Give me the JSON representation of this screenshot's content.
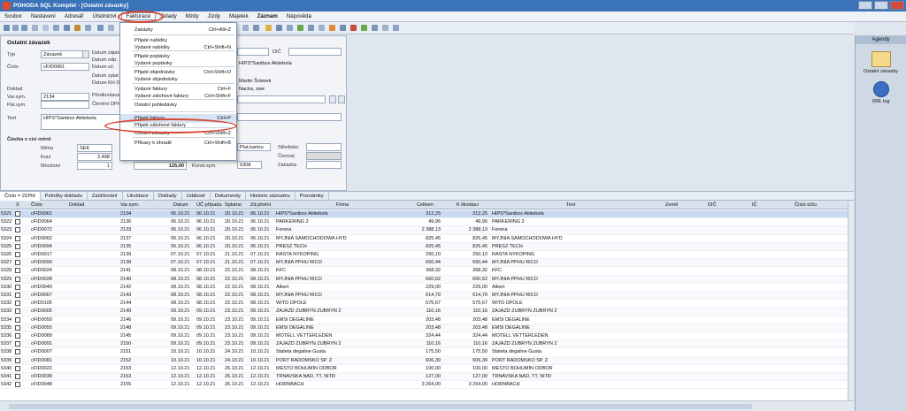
{
  "window": {
    "title": "POHODA SQL Komplet - [Ostatní závazky]"
  },
  "menu": [
    "Soubor",
    "Nastavení",
    "Adresář",
    "Účetnictví",
    "Fakturace",
    "Sklady",
    "Mzdy",
    "Jízdy",
    "Majetek",
    "Záznam",
    "Nápověda"
  ],
  "fakturace_menu": [
    {
      "label": "Zakázky",
      "shortcut": "Ctrl+Alt+Z"
    },
    {
      "label": "Přijaté nabídky",
      "shortcut": ""
    },
    {
      "label": "Vydané nabídky",
      "shortcut": "Ctrl+Shift+N"
    },
    {
      "label": "Přijaté poptávky",
      "shortcut": ""
    },
    {
      "label": "Vydané poptávky",
      "shortcut": ""
    },
    {
      "label": "Přijaté objednávky",
      "shortcut": "Ctrl+Shift+O"
    },
    {
      "label": "Vydané objednávky",
      "shortcut": ""
    },
    {
      "label": "Vydané faktury",
      "shortcut": "Ctrl+F"
    },
    {
      "label": "Vydané zálohové faktury",
      "shortcut": "Ctrl+Shift+F"
    },
    {
      "label": "Ostatní pohledávky",
      "shortcut": ""
    },
    {
      "label": "Přijaté faktury",
      "shortcut": "Ctrl+P"
    },
    {
      "label": "Přijaté zálohové faktury",
      "shortcut": ""
    },
    {
      "label": "Ostatní závazky",
      "shortcut": "Ctrl+Shift+Z"
    },
    {
      "label": "Příkazy k úhradě",
      "shortcut": "Ctrl+Shift+B"
    }
  ],
  "agendy": {
    "header": "Agendy",
    "item1": "Ostatní závazky",
    "item2": "XML log"
  },
  "form": {
    "title": "Ostatní závazek",
    "typ_label": "Typ",
    "typ_value": "Závazek",
    "cislo_label": "Číslo",
    "cislo_value": "cFID0061",
    "datum_zapisu": "Datum zápisu",
    "datum_odp": "Datum odp.",
    "datum_splat": "Datum splat",
    "datum_uc": "Datum uč.",
    "datum_kh": "Datum KH D",
    "doklad_label": "Doklad",
    "varsym_label": "Var.sym.",
    "varsym_value": "2134",
    "parsym_label": "Pár.sym.",
    "predkontace": "Předkontace",
    "cleneni": "Členění DPH",
    "text_label": "Text",
    "text_value": "HIPS*Sanibox Aktiebola",
    "castka_label": "Částka v cizí měně",
    "mena_label": "Měna",
    "mena_value": "SEK",
    "kurz_label": "Kurz",
    "kurz_value": "2,498",
    "mnozstvi_label": "Množství",
    "mnozstvi_value": "1",
    "amount": "125,00",
    "konst_label": "Konst.sym.",
    "konst_value": "0308",
    "firma": "HIPS*Sanibox Aktiebola",
    "osoba": "Martin Šrámek",
    "mesto": "Nacka, swe",
    "dic_label": "DIČ",
    "plat_label": "Plat.kartou",
    "stredisko": "Středisko",
    "cinnost": "Činnost",
    "zakazka": "Zakázka"
  },
  "tabs": [
    "Číslo = 21Pid",
    "Položky dokladu",
    "Zaúčtování",
    "Likvidace",
    "Doklady",
    "Události",
    "Dokumenty",
    "Historie záznamu",
    "Poznámky"
  ],
  "columns": [
    "X",
    "Číslo",
    "Doklad",
    "Var.sym.",
    "Datum",
    "ÚČ případu",
    "Splatno",
    "Zd.plnění",
    "Firma",
    "Celkem",
    "K likvidaci",
    "Text",
    "Země",
    "DIČ",
    "IČ",
    "Číslo účtu"
  ],
  "rows": [
    [
      "5321",
      "cFID0061",
      "2134",
      "06.10.21",
      "06.10.21",
      "20.10.21",
      "06.10.21",
      "HIPS*Sanibox Aktiebola",
      "312,25",
      "312,25",
      "HIPS*Sanibox Aktiebola"
    ],
    [
      "5322",
      "cFID0064",
      "2136",
      "06.10.21",
      "06.10.21",
      "20.10.21",
      "06.10.21",
      "PARKERING 2",
      "49,96",
      "49,96",
      "PARKERING 2"
    ],
    [
      "5323",
      "cFID0072",
      "2133",
      "06.10.21",
      "06.10.21",
      "20.10.21",
      "06.10.21",
      "Ferona",
      "2 388,13",
      "2 388,13",
      "Ferona"
    ],
    [
      "5324",
      "cFID0062",
      "2137",
      "06.10.21",
      "06.10.21",
      "20.10.21",
      "06.10.21",
      "MYJNIA SAMOCHODOWA HYD",
      "825,45",
      "825,45",
      "MYJNIA SAMOCHODOWA HYD"
    ],
    [
      "5325",
      "cFID0094",
      "2135",
      "06.10.21",
      "06.10.21",
      "20.10.21",
      "06.10.21",
      "PRESZ TECH",
      "825,45",
      "825,45",
      "PRESZ TECH"
    ],
    [
      "5326",
      "cFID0017",
      "2139",
      "07.10.21",
      "07.10.21",
      "21.10.21",
      "07.10.21",
      "RASTA NYKOPING",
      "250,10",
      "250,10",
      "RASTA NYKOPING"
    ],
    [
      "5327",
      "cFID0099",
      "2138",
      "07.10.21",
      "07.10.21",
      "21.10.21",
      "07.10.21",
      "MYJNIA PPHU RICO",
      "650,44",
      "650,44",
      "MYJNIA PPHU RICO"
    ],
    [
      "5328",
      "cFID0024",
      "2141",
      "08.10.21",
      "08.10.21",
      "22.10.21",
      "08.10.21",
      "KFC",
      "368,32",
      "368,32",
      "KFC"
    ],
    [
      "5329",
      "cFID0028",
      "2140",
      "08.10.21",
      "08.10.21",
      "22.10.21",
      "08.10.21",
      "MYJNIA PPHU RICO",
      "660,62",
      "660,62",
      "MYJNIA PPHU RICO"
    ],
    [
      "5330",
      "cFID0040",
      "2142",
      "08.10.21",
      "08.10.21",
      "22.10.21",
      "08.10.21",
      "Albert",
      "229,00",
      "229,00",
      "Albert"
    ],
    [
      "5331",
      "cFID0067",
      "2143",
      "08.10.21",
      "08.10.21",
      "22.10.21",
      "08.10.21",
      "MYJNIA PPHU RICO",
      "614,79",
      "614,79",
      "MYJNIA PPHU RICO"
    ],
    [
      "5332",
      "cFID0105",
      "2144",
      "08.10.21",
      "08.10.21",
      "22.10.21",
      "08.10.21",
      "WITD OPOLE",
      "575,67",
      "575,67",
      "WITD OPOLE"
    ],
    [
      "5333",
      "cFID0005",
      "2149",
      "09.10.21",
      "09.10.21",
      "23.10.21",
      "09.10.21",
      "ZAJAZD ZUBRYN ZUBRYN 2",
      "110,16",
      "110,16",
      "ZAJAZD ZUBRYN ZUBRYN 2"
    ],
    [
      "5334",
      "cFID0050",
      "2146",
      "09.10.21",
      "09.10.21",
      "23.10.21",
      "09.10.21",
      "EMSI DEGALINE",
      "203,48",
      "203,48",
      "EMSI DEGALINE"
    ],
    [
      "5335",
      "cFID0055",
      "2148",
      "09.10.21",
      "09.10.21",
      "23.10.21",
      "09.10.21",
      "EMSI DEGALINE",
      "203,48",
      "203,48",
      "EMSI DEGALINE"
    ],
    [
      "5336",
      "cFID0089",
      "2145",
      "09.10.21",
      "09.10.21",
      "23.10.21",
      "09.10.21",
      "MOTELL VETTERLEDEN",
      "324,44",
      "324,44",
      "MOTELL VETTERLEDEN"
    ],
    [
      "5337",
      "cFID0091",
      "2150",
      "09.10.21",
      "09.10.21",
      "23.10.21",
      "09.10.21",
      "ZAJAZD ZUBRYN ZUBRYN 2",
      "110,16",
      "110,16",
      "ZAJAZD ZUBRYN ZUBRYN 2"
    ],
    [
      "5338",
      "cFID0007",
      "2151",
      "10.10.21",
      "10.10.21",
      "24.10.21",
      "10.10.21",
      "Stateta degaline Gusta",
      "175,50",
      "175,50",
      "Stateta degaline Gusta"
    ],
    [
      "5339",
      "cFID0081",
      "2152",
      "10.10.21",
      "10.10.21",
      "24.10.21",
      "10.10.21",
      "PORT RADOMSKO SP. Z",
      "606,39",
      "606,39",
      "PORT RADOMSKO SP. Z"
    ],
    [
      "5340",
      "cFID0022",
      "2153",
      "12.10.21",
      "12.10.21",
      "26.10.21",
      "12.10.21",
      "MESTO BOHUMIN ODBOR",
      "100,00",
      "100,00",
      "MESTO BOHUMIN ODBOR"
    ],
    [
      "5341",
      "cFID0038",
      "2153",
      "12.10.21",
      "12.10.21",
      "26.10.21",
      "12.10.21",
      "TRNAVSKA NAD, TT, NITR",
      "127,00",
      "127,00",
      "TRNAVSKA NAD, TT, NITR"
    ],
    [
      "5342",
      "cFID0048",
      "2155",
      "12.10.21",
      "12.10.21",
      "26.10.21",
      "12.10.21",
      "HORNBACH",
      "3 264,00",
      "3 264,00",
      "HORNBACH"
    ]
  ]
}
